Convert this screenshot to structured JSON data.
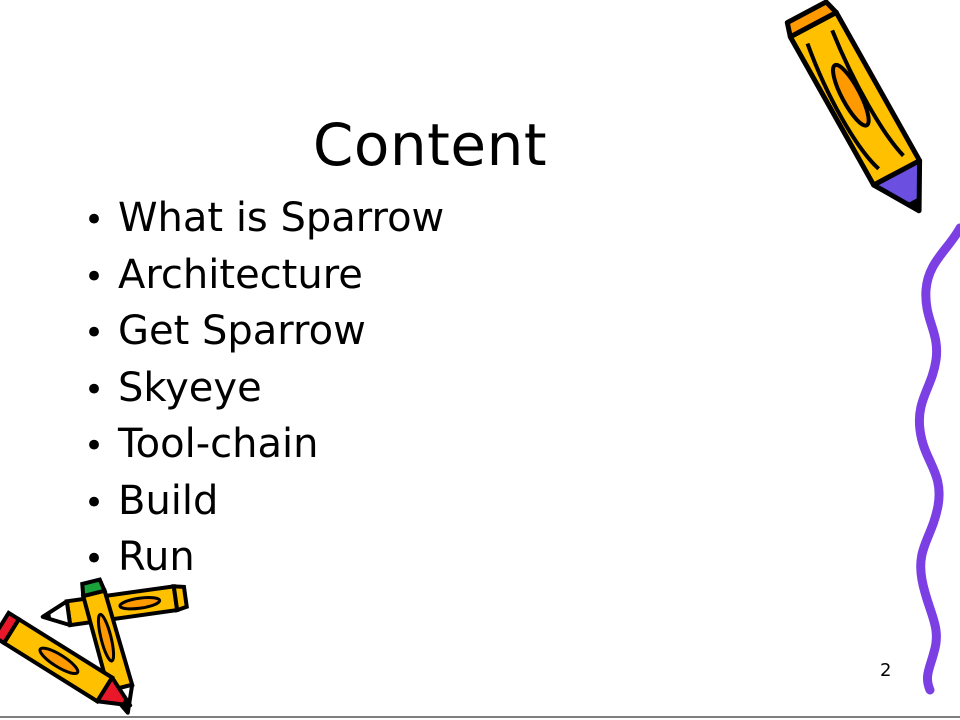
{
  "slide": {
    "title": "Content",
    "bullet_glyph": "•",
    "bullets": [
      {
        "label": "What is Sparrow"
      },
      {
        "label": "Architecture"
      },
      {
        "label": "Get Sparrow"
      },
      {
        "label": "Skyeye"
      },
      {
        "label": "Tool-chain"
      },
      {
        "label": "Build"
      },
      {
        "label": "Run"
      }
    ],
    "page_number": "2"
  },
  "decorations": {
    "top_right": "pencil-icon",
    "right_edge": "squiggle-line",
    "bottom_left": "pencils-cluster-icon",
    "colors": {
      "pencil_body": "#ffc000",
      "pencil_stripe": "#ff9900",
      "pencil_tip_blue": "#6b4fe0",
      "pencil_red": "#e8182a",
      "pencil_green": "#1aa33a",
      "squiggle": "#7b3fe4",
      "outline": "#000000"
    }
  }
}
